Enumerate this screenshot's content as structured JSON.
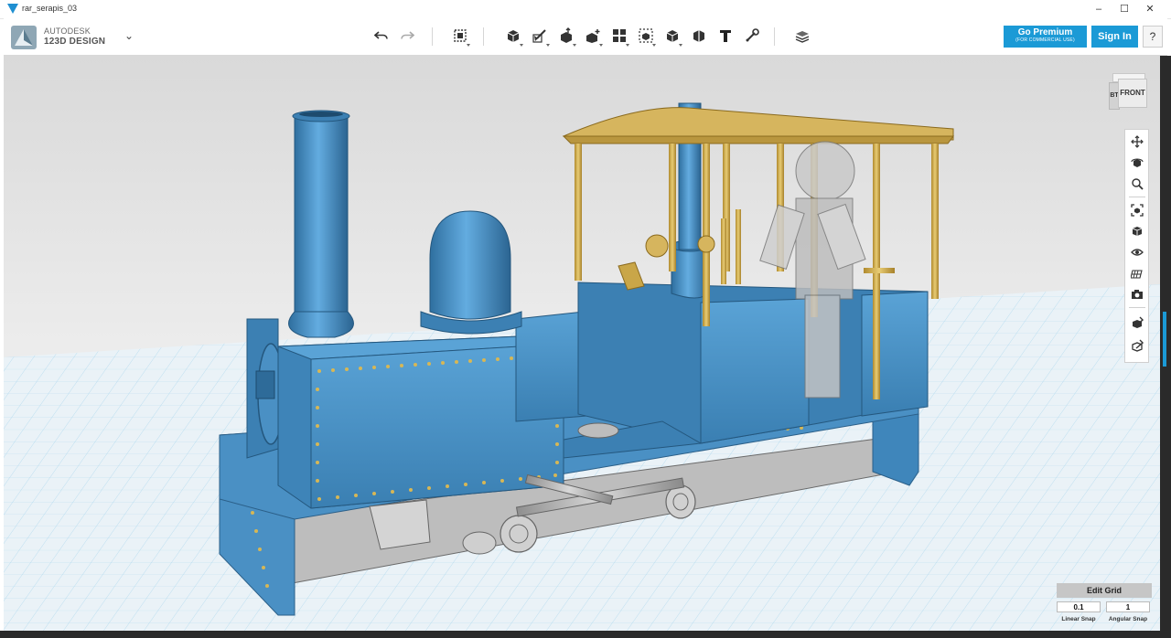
{
  "window": {
    "title": "rar_serapis_03",
    "controls": {
      "minimize": "–",
      "maximize": "☐",
      "close": "✕"
    }
  },
  "logo": {
    "line1": "AUTODESK",
    "line2": "123D DESIGN",
    "menu_chevron": "⌄"
  },
  "toolbar": {
    "groups": [
      [
        "undo-icon",
        "redo-icon"
      ],
      [
        "transform-icon"
      ],
      [
        "primitives-icon",
        "sketch-icon",
        "construct-icon",
        "modify-icon",
        "pattern-icon",
        "group-icon",
        "combine-icon",
        "measure-icon",
        "text-icon",
        "snap-icon"
      ],
      [
        "material-icon"
      ]
    ]
  },
  "account": {
    "premium_label": "Go Premium",
    "premium_sub": "(FOR COMMERCIAL USE)",
    "signin_label": "Sign In",
    "help_label": "?"
  },
  "viewcube": {
    "front_label": "FRONT",
    "side_label": "BT"
  },
  "nav_tools": [
    "pan-icon",
    "orbit-icon",
    "zoom-icon",
    "fit-icon",
    "view-mode-icon",
    "visibility-icon",
    "grid-toggle-icon",
    "screenshot-icon",
    "material-toggle-icon",
    "outline-toggle-icon"
  ],
  "grid_panel": {
    "title": "Edit Grid",
    "linear_snap_value": "0.1",
    "angular_snap_value": "1",
    "linear_snap_label": "Linear Snap",
    "angular_snap_label": "Angular Snap"
  },
  "colors": {
    "accent": "#1b9ad6",
    "model_body": "#4a90c4",
    "model_brass": "#d6b55e",
    "grid_background": "#e9eef2",
    "grid_lines": "#9fd0ea"
  }
}
